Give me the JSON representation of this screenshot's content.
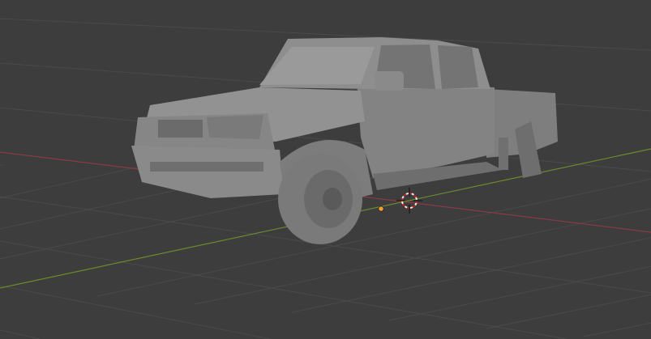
{
  "viewport": {
    "background_color": "#3d3d3d",
    "grid_color": "#4a4a4a",
    "x_axis_color": "#8a3a42",
    "y_axis_color": "#6a8a2c",
    "model_color": "#8c8c8c",
    "origin_color": "#f0a030",
    "cursor_color": "#d02020",
    "icons": [
      "3d-cursor-icon",
      "object-origin-icon"
    ]
  }
}
